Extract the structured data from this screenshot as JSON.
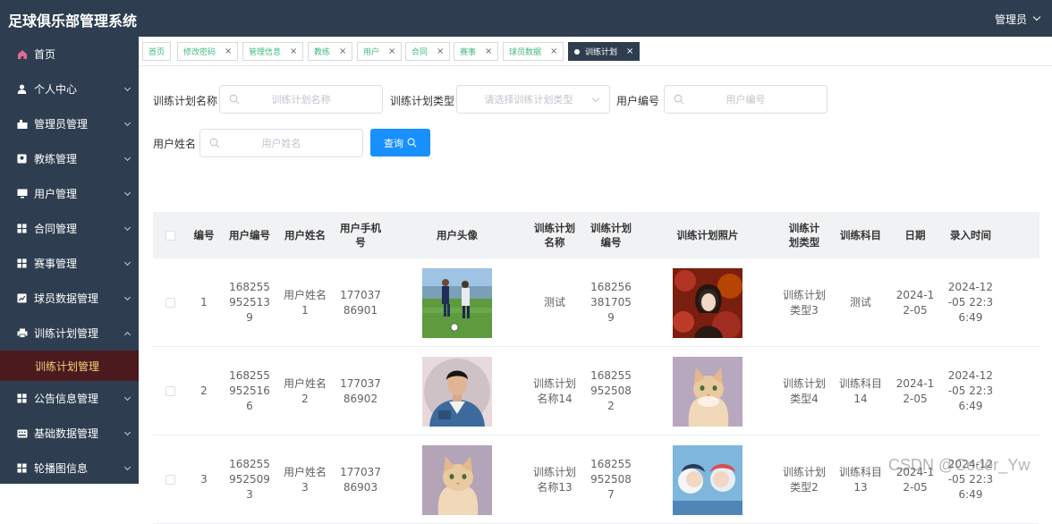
{
  "app": {
    "title": "足球俱乐部管理系统",
    "user": "管理员"
  },
  "sidebar": {
    "items": [
      {
        "label": "首页",
        "icon": "home-icon",
        "arrow": false
      },
      {
        "label": "个人中心",
        "icon": "user-icon",
        "arrow": true
      },
      {
        "label": "管理员管理",
        "icon": "admin-icon",
        "arrow": true
      },
      {
        "label": "教练管理",
        "icon": "coach-icon",
        "arrow": true
      },
      {
        "label": "用户管理",
        "icon": "monitor-icon",
        "arrow": true
      },
      {
        "label": "合同管理",
        "icon": "grid-icon",
        "arrow": true
      },
      {
        "label": "赛事管理",
        "icon": "grid-icon",
        "arrow": true
      },
      {
        "label": "球员数据管理",
        "icon": "chart-icon",
        "arrow": true
      },
      {
        "label": "训练计划管理",
        "icon": "print-icon",
        "arrow": true
      }
    ],
    "sub_active": "训练计划管理",
    "items2": [
      {
        "label": "公告信息管理",
        "icon": "grid-icon",
        "arrow": true
      },
      {
        "label": "基础数据管理",
        "icon": "keyboard-icon",
        "arrow": true
      },
      {
        "label": "轮播图信息",
        "icon": "grid-icon",
        "arrow": true
      }
    ]
  },
  "tabs": [
    "首页",
    "修改密码",
    "管理信息",
    "教练",
    "用户",
    "合同",
    "赛事",
    "球员数据",
    "训练计划"
  ],
  "filters": {
    "plan_name_label": "训练计划名称",
    "plan_name_placeholder": "训练计划名称",
    "plan_type_label": "训练计划类型",
    "plan_type_placeholder": "请选择训练计划类型",
    "user_no_label": "用户编号",
    "user_no_placeholder": "用户编号",
    "user_name_label": "用户姓名",
    "user_name_placeholder": "用户姓名",
    "query_label": "查询"
  },
  "table": {
    "headers": [
      "编号",
      "用户编号",
      "用户姓名",
      "用户手机号",
      "用户头像",
      "训练计划名称",
      "训练计划编号",
      "训练计划照片",
      "训练计划类型",
      "训练科目",
      "日期",
      "录入时间"
    ],
    "rows": [
      {
        "id": "1",
        "user_no": "1682559525139",
        "user_name": "用户姓名1",
        "phone": "17703786901",
        "avatar": "soccer-photo",
        "plan_name": "测试",
        "plan_no": "1682563817059",
        "plan_photo": "woman-photo",
        "plan_type": "训练计划类型3",
        "subject": "测试",
        "date": "2024-12-05",
        "created": "2024-12-05 22:36:49"
      },
      {
        "id": "2",
        "user_no": "1682559525166",
        "user_name": "用户姓名2",
        "phone": "17703786902",
        "avatar": "man-portrait",
        "plan_name": "训练计划名称14",
        "plan_no": "1682559525082",
        "plan_photo": "cat-photo",
        "plan_type": "训练计划类型4",
        "subject": "训练科目14",
        "date": "2024-12-05",
        "created": "2024-12-05 22:36:49"
      },
      {
        "id": "3",
        "user_no": "1682559525093",
        "user_name": "用户姓名3",
        "phone": "17703786903",
        "avatar": "cat-photo",
        "plan_name": "训练计划名称13",
        "plan_no": "1682559525087",
        "plan_photo": "anime-photo",
        "plan_type": "训练计划类型2",
        "subject": "训练科目13",
        "date": "2024-12-05",
        "created": "2024-12-05 22:36:49"
      }
    ]
  },
  "watermark": "CSDN @Coder_Yw",
  "colors": {
    "sidebar": "#2e3e50",
    "accent": "#1890ff",
    "tag_text": "#42b983",
    "active_sub_bg": "#4a1a1e",
    "active_sub_text": "#f2d47a"
  }
}
